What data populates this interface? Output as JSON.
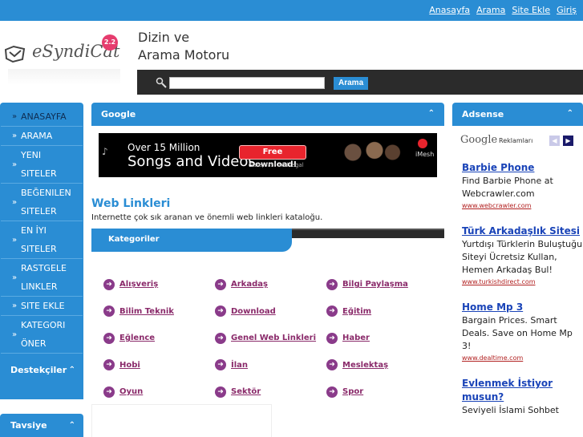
{
  "topnav": [
    "Anasayfa",
    "Arama",
    "Site Ekle",
    "Giriş"
  ],
  "logo": {
    "text": "eSyndiCat",
    "badge": "2.2"
  },
  "site_title": {
    "line1": "Dizin ve",
    "line2": "Arama Motoru"
  },
  "search": {
    "value": "",
    "button": "Arama"
  },
  "menu": {
    "items": [
      {
        "label": "ANASAYFA",
        "active": true
      },
      {
        "label": "ARAMA"
      },
      {
        "label": "YENI SITELER"
      },
      {
        "label": "BEĞENILEN SITELER"
      },
      {
        "label": "EN İYI SITELER"
      },
      {
        "label": "RASTGELE LINKLER"
      },
      {
        "label": "SITE EKLE"
      },
      {
        "label": "KATEGORI ÖNER"
      }
    ],
    "supporters": "Destekçiler",
    "recommend": "Tavsiye"
  },
  "center": {
    "google_head": "Google",
    "banner": {
      "line1": "Over 15 Million",
      "line2": "Songs and Videos",
      "button": "Free Download!",
      "sub": "Safe, fast and legal",
      "brand": "iMesh"
    },
    "title": "Web Linkleri",
    "description": "Internette çok sık aranan ve önemli web linkleri kataloğu.",
    "categories_tab": "Kategoriler",
    "categories": [
      [
        "Alışveriş",
        "Arkadaş",
        "Bilgi Paylaşma"
      ],
      [
        "Bilim Teknik",
        "Download",
        "Eğitim"
      ],
      [
        "Eğlence",
        "Genel Web Linkleri",
        "Haber"
      ],
      [
        "Hobi",
        "İlan",
        "Meslektaş"
      ],
      [
        "Oyun",
        "Sektör",
        "Spor"
      ]
    ]
  },
  "right": {
    "adsense_head": "Adsense",
    "google_logo": "Google",
    "google_label": "Reklamları",
    "ads": [
      {
        "title": "Barbie Phone",
        "body": "Find Barbie Phone at Webcrawler.com",
        "url": "www.webcrawler.com"
      },
      {
        "title": "Türk Arkadaşlık Sitesi",
        "body": "Yurtdışı Türklerin Buluştuğu Siteyi Ücretsiz Kullan, Hemen Arkadaş Bul!",
        "url": "www.turkishdirect.com"
      },
      {
        "title": "Home Mp 3",
        "body": "Bargain Prices. Smart Deals. Save on Home Mp 3!",
        "url": "www.dealtime.com"
      },
      {
        "title": "Evlenmek İstiyor musun?",
        "body": "Seviyeli İslami Sohbet",
        "url": ""
      }
    ]
  },
  "colors": {
    "primary": "#2a8dd4",
    "dark": "#2b2b2b",
    "category_link": "#8a2a6a",
    "ad_title": "#1a44b8",
    "ad_url": "#b22222"
  }
}
